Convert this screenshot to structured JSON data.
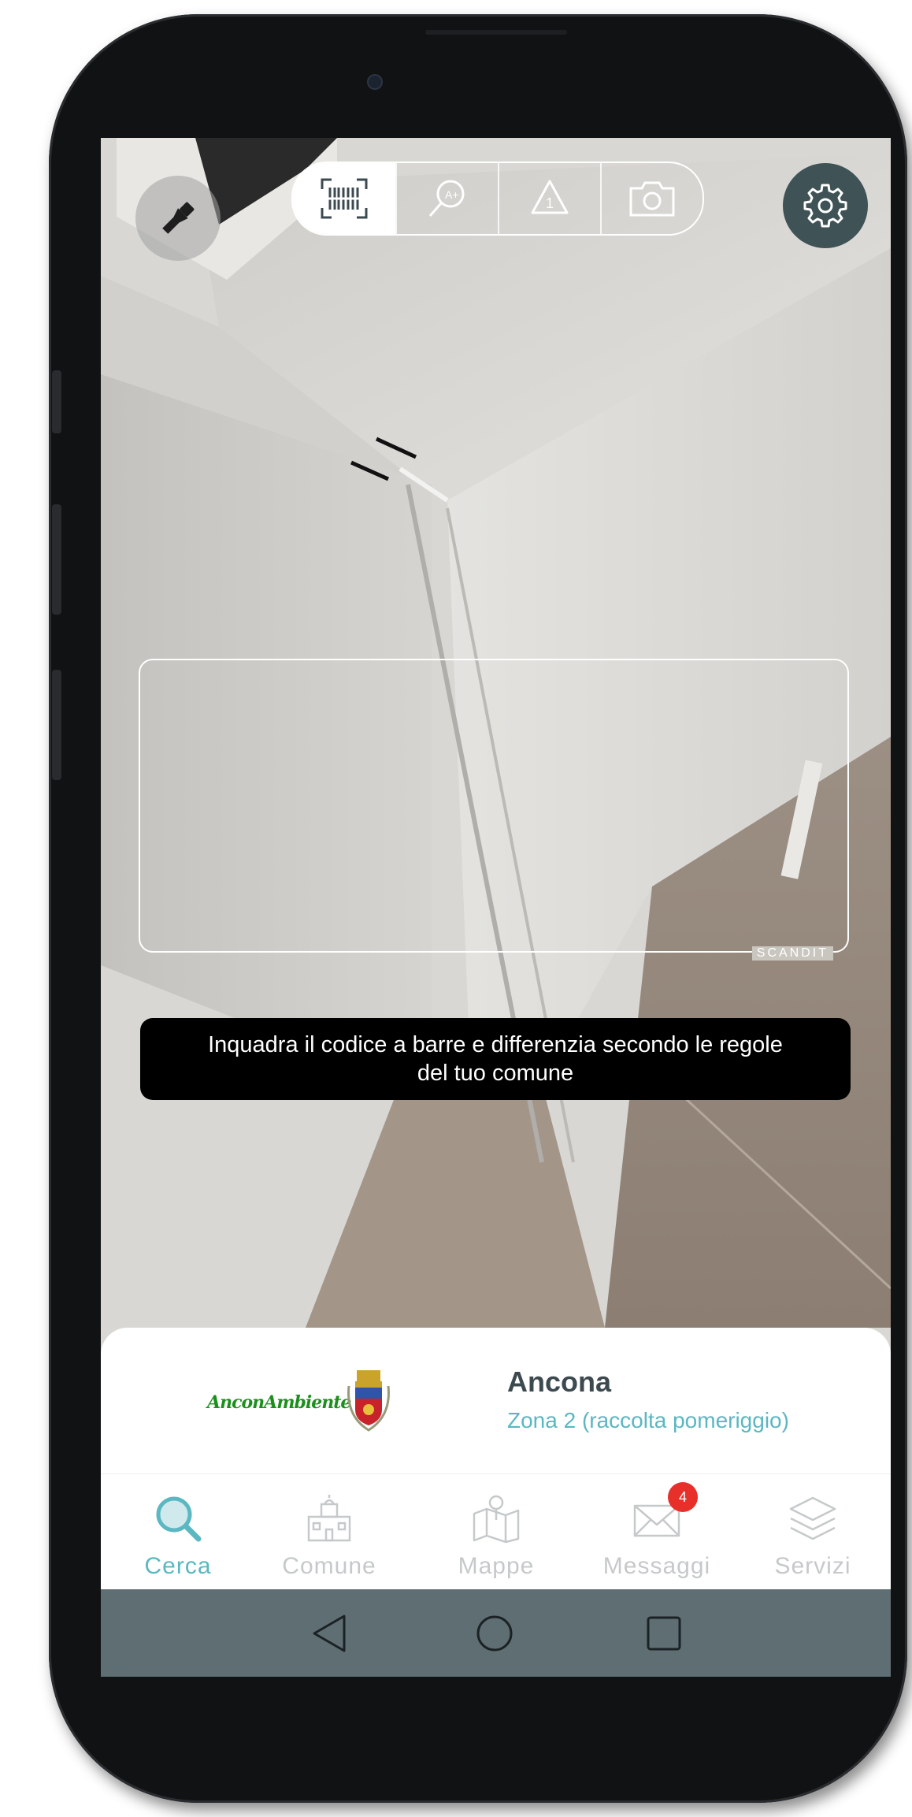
{
  "camera": {
    "scan_modes": [
      {
        "icon": "barcode-scan-icon",
        "active": true
      },
      {
        "icon": "magnifier-label-icon",
        "active": false
      },
      {
        "icon": "recycle-triangle-icon",
        "active": false
      },
      {
        "icon": "camera-icon",
        "active": false
      }
    ],
    "flash_icon": "flashlight-icon",
    "settings_icon": "gear-icon",
    "scanner_brand": "SCANDIT",
    "hint": "Inquadra il codice a barre e differenzia secondo le regole del tuo comune"
  },
  "info": {
    "logo_text": "AnconAmbiente",
    "city": "Ancona",
    "zone": "Zona 2 (raccolta pomeriggio)"
  },
  "tabs": [
    {
      "label": "Cerca",
      "icon": "search-icon",
      "active": true
    },
    {
      "label": "Comune",
      "icon": "town-hall-icon",
      "active": false
    },
    {
      "label": "Mappe",
      "icon": "map-pin-icon",
      "active": false
    },
    {
      "label": "Messaggi",
      "icon": "mail-icon",
      "active": false,
      "badge": "4"
    },
    {
      "label": "Servizi",
      "icon": "layers-icon",
      "active": false
    }
  ],
  "colors": {
    "accent": "#5bb7c1",
    "badge": "#e8302a",
    "navbar": "#5f6e72",
    "settings_button": "#3f5256"
  }
}
